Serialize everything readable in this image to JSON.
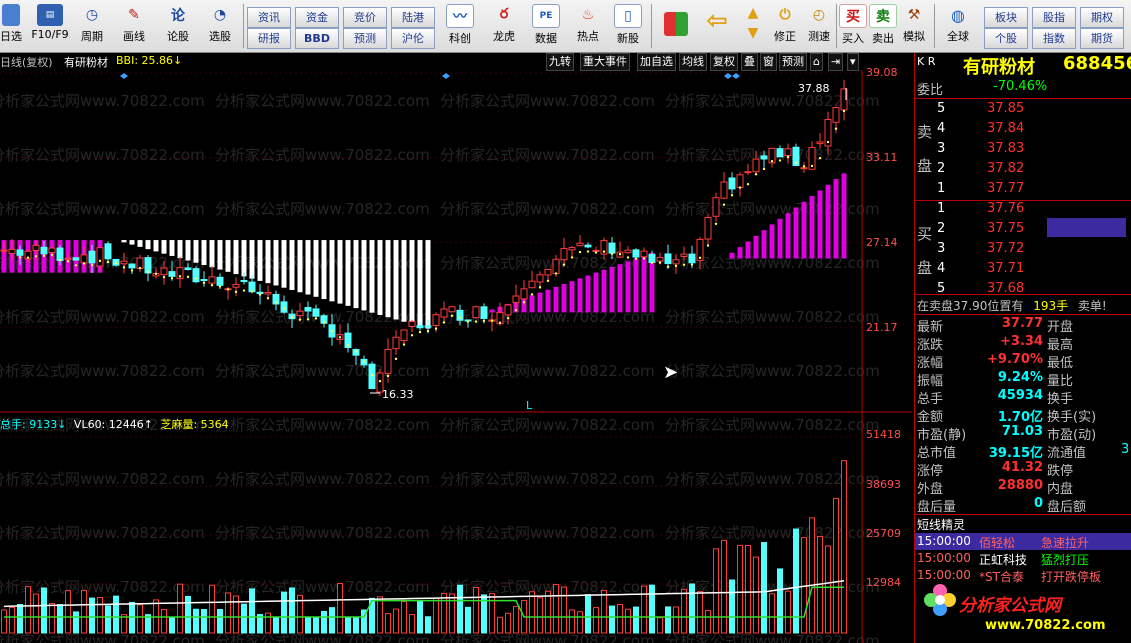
{
  "toolbar": {
    "items": [
      {
        "label": "日选",
        "icon": "grid-icon"
      },
      {
        "label": "F10/F9",
        "icon": "f10-icon"
      },
      {
        "label": "周期",
        "icon": "clock-icon"
      },
      {
        "label": "画线",
        "icon": "pencil-icon"
      },
      {
        "label": "论股",
        "icon": "comment-icon"
      },
      {
        "label": "选股",
        "icon": "chart-icon"
      },
      {
        "label": "科创",
        "icon": "line-chart-icon"
      },
      {
        "label": "龙虎",
        "icon": "dragon-icon"
      },
      {
        "label": "数据",
        "icon": "pe-icon"
      },
      {
        "label": "热点",
        "icon": "fire-icon"
      },
      {
        "label": "新股",
        "icon": "new-stock-icon"
      },
      {
        "label": "修正",
        "icon": "fix-icon"
      },
      {
        "label": "测速",
        "icon": "stopwatch-icon"
      },
      {
        "label": "买入",
        "icon": "buy-icon"
      },
      {
        "label": "卖出",
        "icon": "sell-icon"
      },
      {
        "label": "模拟",
        "icon": "hammer-icon"
      },
      {
        "label": "全球",
        "icon": "globe-icon"
      }
    ],
    "small_buttons": [
      "资讯",
      "研报",
      "资金",
      "BBD",
      "竞价",
      "预测",
      "陆港",
      "沪伦",
      "板块",
      "个股",
      "股指",
      "指数",
      "期权",
      "期货"
    ],
    "buy_glyph": "买",
    "sell_glyph": "卖",
    "back_arrow": "⇦",
    "up_arrow": "▲",
    "down_arrow": "▼"
  },
  "chart": {
    "period_label": "日线(复权)",
    "stock_name": "有研粉材",
    "bbi_label": "BBI: 25.86↓",
    "tabs": [
      "九转",
      "重大事件",
      "加自选",
      "均线",
      "复权",
      "叠",
      "窗",
      "预测"
    ],
    "price_ticks": [
      "39.08",
      "33.11",
      "27.14",
      "21.17"
    ],
    "high_label": "37.88",
    "low_label": "16.33",
    "marker_L": "L",
    "volume_header": {
      "total": "总手: 9133↓",
      "vl60": "VL60: 12446↑",
      "zhima": "芝麻量: 5364"
    },
    "vol_ticks": [
      "51418",
      "38693",
      "25709",
      "12984"
    ],
    "watermark": "分析家公式网www.70822.com"
  },
  "chart_data": {
    "type": "candlestick",
    "title": "有研粉材 日线(复权)",
    "ylim": [
      13.5,
      40.5
    ],
    "price_ticks": [
      39.08,
      33.11,
      27.14,
      21.17
    ],
    "bbi_last": 25.86,
    "marked_high": 37.88,
    "marked_low": 16.33,
    "volume_ticks": [
      51418,
      38693,
      25709,
      12984
    ],
    "volume_header": {
      "total": 9133,
      "vl60": 12446,
      "zhima": 5364
    }
  },
  "right_panel": {
    "code_prefix": "K R",
    "title": "有研粉材",
    "code": "688456",
    "weibi_label": "委比",
    "weibi_value": "-70.46%",
    "sell_side_label": [
      "卖",
      "盘"
    ],
    "buy_side_label": [
      "买",
      "盘"
    ],
    "sell_levels": [
      {
        "level": "5",
        "price": "37.85"
      },
      {
        "level": "4",
        "price": "37.84"
      },
      {
        "level": "3",
        "price": "37.83"
      },
      {
        "level": "2",
        "price": "37.82"
      },
      {
        "level": "1",
        "price": "37.77"
      }
    ],
    "buy_levels": [
      {
        "level": "1",
        "price": "37.76"
      },
      {
        "level": "2",
        "price": "37.75"
      },
      {
        "level": "3",
        "price": "37.72"
      },
      {
        "level": "4",
        "price": "37.71"
      },
      {
        "level": "5",
        "price": "37.68"
      }
    ],
    "notice_text": "在卖盘37.90位置有",
    "notice_qty": "193手",
    "notice_tail": "卖单!",
    "stats": [
      {
        "l1": "最新",
        "v1": "37.77",
        "l2": "开盘",
        "v2": ""
      },
      {
        "l1": "涨跌",
        "v1": "+3.34",
        "l2": "最高",
        "v2": ""
      },
      {
        "l1": "涨幅",
        "v1": "+9.70%",
        "l2": "最低",
        "v2": ""
      },
      {
        "l1": "振幅",
        "v1": "9.24%",
        "l2": "量比",
        "v2": ""
      },
      {
        "l1": "总手",
        "v1": "45934",
        "l2": "换手",
        "v2": ""
      },
      {
        "l1": "金额",
        "v1": "1.70亿",
        "l2": "换手(实)",
        "v2": ""
      },
      {
        "l1": "市盈(静)",
        "v1": "71.03",
        "l2": "市盈(动)",
        "v2": ""
      },
      {
        "l1": "总市值",
        "v1": "39.15亿",
        "l2": "流通值",
        "v2": "3"
      },
      {
        "l1": "涨停",
        "v1": "41.32",
        "l2": "跌停",
        "v2": ""
      },
      {
        "l1": "外盘",
        "v1": "28880",
        "l2": "内盘",
        "v2": ""
      },
      {
        "l1": "盘后量",
        "v1": "0",
        "l2": "盘后额",
        "v2": ""
      }
    ],
    "sprite_title": "短线精灵",
    "sprites": [
      {
        "time": "15:00:00",
        "name": "佰轻松",
        "event": "急速拉升"
      },
      {
        "time": "15:00:00",
        "name": "正虹科技",
        "event": "猛烈打压"
      },
      {
        "time": "15:00:00",
        "name": "*ST合泰",
        "event": "打开跌停板"
      }
    ],
    "logo_text": "分析家公式网",
    "logo_url": "www.70822.com"
  }
}
